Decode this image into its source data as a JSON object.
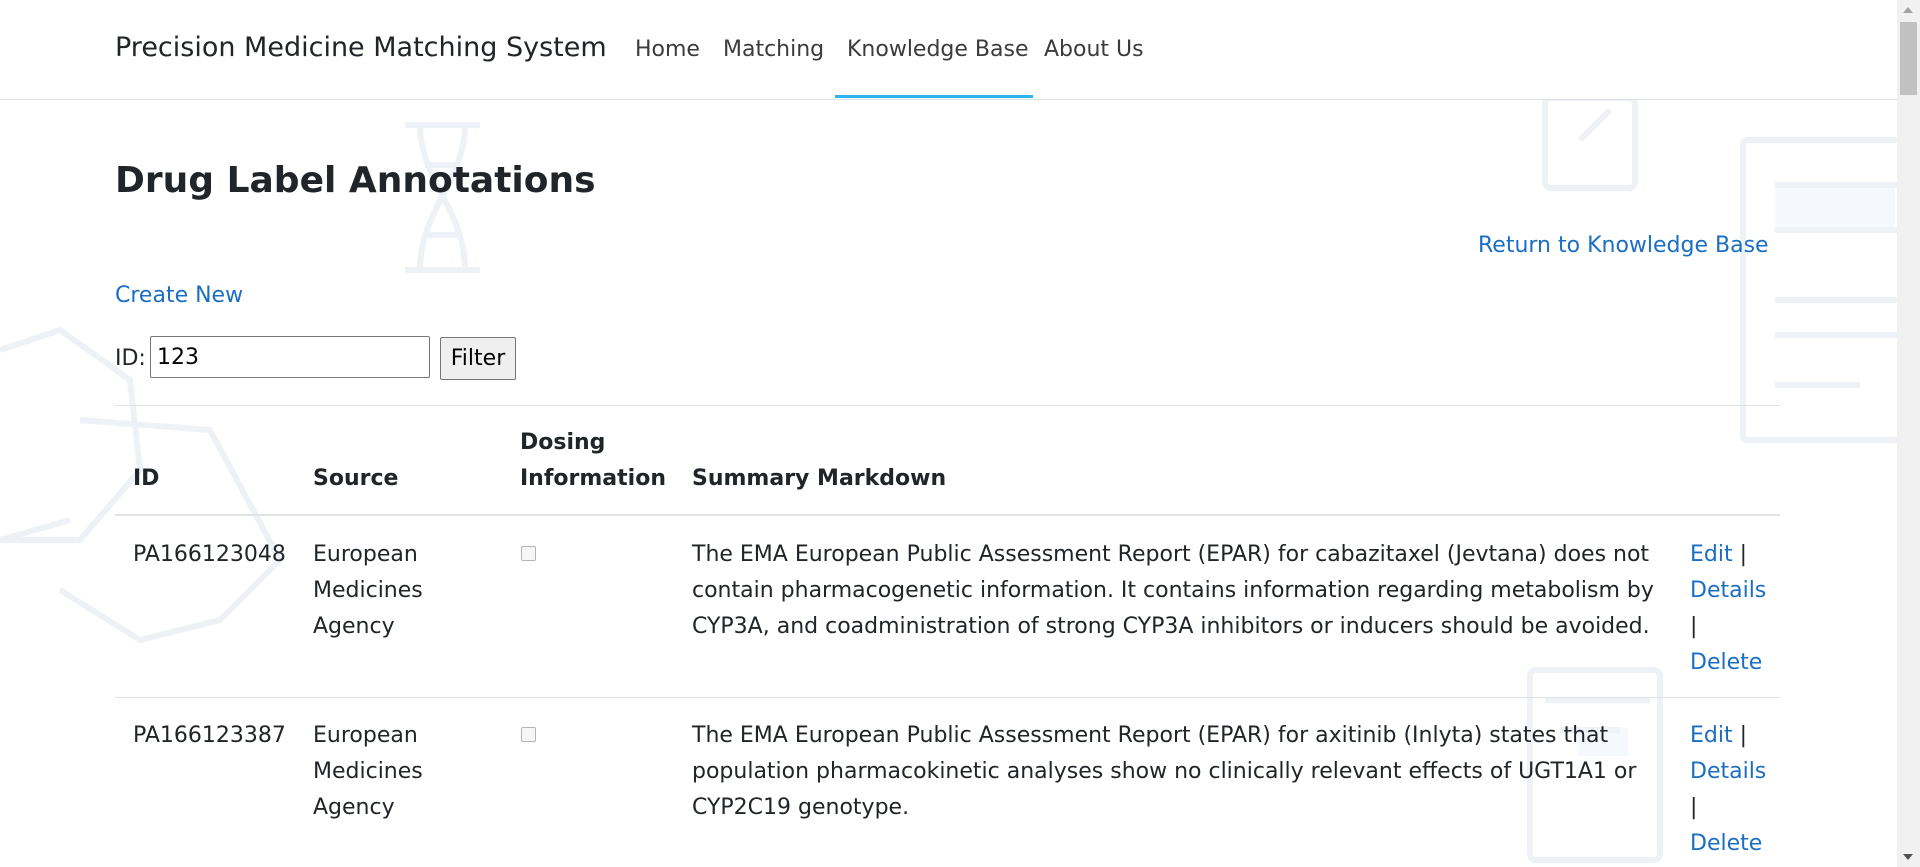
{
  "nav": {
    "brand": "Precision Medicine Matching System",
    "items": [
      {
        "label": "Home"
      },
      {
        "label": "Matching"
      },
      {
        "label": "Knowledge Base",
        "active": true
      },
      {
        "label": "About Us"
      }
    ]
  },
  "page": {
    "title": "Drug Label Annotations",
    "return_link": "Return to Knowledge Base",
    "create_link": "Create New"
  },
  "filter": {
    "label": "ID:",
    "value": "123",
    "button": "Filter"
  },
  "table": {
    "headers": {
      "id": "ID",
      "source": "Source",
      "dosing_line1": "Dosing",
      "dosing_line2": "Information",
      "summary": "Summary Markdown"
    },
    "rows": [
      {
        "id": "PA166123048",
        "source_lines": [
          "European",
          "Medicines",
          "Agency"
        ],
        "dosing_checked": false,
        "summary_lines": [
          "The EMA European Public Assessment Report (EPAR) for cabazitaxel (Jevtana) does not",
          "contain pharmacogenetic information. It contains information regarding metabolism by",
          "CYP3A, and coadministration of strong CYP3A inhibitors or inducers should be avoided."
        ],
        "actions": {
          "edit": "Edit",
          "details": "Details",
          "delete": "Delete",
          "separator": "|"
        }
      },
      {
        "id": "PA166123387",
        "source_lines": [
          "European",
          "Medicines",
          "Agency"
        ],
        "dosing_checked": false,
        "summary_lines": [
          "The EMA European Public Assessment Report (EPAR) for axitinib (Inlyta) states that",
          "population pharmacokinetic analyses show no clinically relevant effects of UGT1A1 or",
          "CYP2C19 genotype."
        ],
        "actions": {
          "edit": "Edit",
          "details": "Details",
          "delete": "Delete",
          "separator": "|"
        }
      }
    ]
  },
  "colors": {
    "link": "#1b6ec2",
    "active_tab_underline": "#2fb3ee",
    "text": "#212529"
  }
}
